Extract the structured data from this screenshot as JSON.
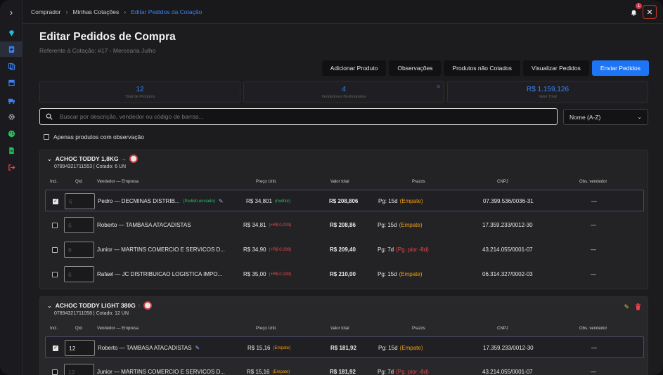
{
  "breadcrumb": [
    "Comprador",
    "Minhas Cotações",
    "Editar Pedidos da Cotação"
  ],
  "notifications_count": "1",
  "page": {
    "title": "Editar Pedidos de Compra",
    "subtitle": "Referente à Cotação: #17 - Mercearia Julho"
  },
  "actions": [
    "Adicionar Produto",
    "Observações",
    "Produtos não Cotados",
    "Visualizar Pedidos",
    "Enviar Pedidos"
  ],
  "stats": [
    {
      "value": "12",
      "label": "Total de Produtos"
    },
    {
      "value": "4",
      "label": "Vendedores Destinatários"
    },
    {
      "value": "R$ 1.159,126",
      "label": "Valor Total"
    }
  ],
  "search": {
    "placeholder": "Buscar por descrição, vendedor ou código de barras..."
  },
  "sort": {
    "selected": "Nome (A-Z)"
  },
  "filter": {
    "obs_only_label": "Apenas produtos com observação"
  },
  "columns": [
    "Incl.",
    "Qtd",
    "Vendedor — Empresa",
    "Preço Unit.",
    "Valor total",
    "Prazos",
    "CNPJ",
    "Obs. vendedor"
  ],
  "groups": [
    {
      "name": "ACHOC TODDY 1,8KG",
      "trend": "→",
      "sub": "07894321711553 | Cotado: 6 UN",
      "rows": [
        {
          "checked": true,
          "qty": "6",
          "vendor": "Pedro — DECMINAS DISTRIB...",
          "tag": "(Pedido enviado)",
          "price": "R$ 34,801",
          "diff": "(melhor)",
          "total": "R$ 208,806",
          "prazo": "Pg: 15d",
          "prazo_tag": "(Empate)",
          "cnpj": "07.399.536/0036-31",
          "obs": "—"
        },
        {
          "checked": false,
          "qty": "6",
          "vendor": "Roberto — TAMBASA ATACADISTAS",
          "tag": "",
          "price": "R$ 34,81",
          "diff": "(+R$ 0,009)",
          "total": "R$ 208,86",
          "prazo": "Pg: 15d",
          "prazo_tag": "(Empate)",
          "cnpj": "17.359.233/0012-30",
          "obs": "—"
        },
        {
          "checked": false,
          "qty": "6",
          "vendor": "Junior — MARTINS COMERCIO E SERVICOS D...",
          "tag": "",
          "price": "R$ 34,90",
          "diff": "(+R$ 0,099)",
          "total": "R$ 209,40",
          "prazo": "Pg: 7d",
          "prazo_tag": "(Pg. pior -8d)",
          "cnpj": "43.214.055/0001-07",
          "obs": "—"
        },
        {
          "checked": false,
          "qty": "6",
          "vendor": "Rafael — JC DISTRIBUICAO LOGISTICA IMPO...",
          "tag": "",
          "price": "R$ 35,00",
          "diff": "(+R$ 0,199)",
          "total": "R$ 210,00",
          "prazo": "Pg: 15d",
          "prazo_tag": "(Empate)",
          "cnpj": "06.314.327/0002-03",
          "obs": "—"
        }
      ]
    },
    {
      "name": "ACHOC TODDY LIGHT 380G",
      "trend": "↑",
      "sub": "07894321711058 | Cotado: 12 UN",
      "rows": [
        {
          "checked": true,
          "qty": "12",
          "vendor": "Roberto — TAMBASA ATACADISTAS",
          "tag": "",
          "price": "R$ 15,16",
          "diff": "(Empate)",
          "total": "R$ 181,92",
          "prazo": "Pg: 15d",
          "prazo_tag": "(Empate)",
          "cnpj": "17.359.233/0012-30",
          "obs": "—"
        },
        {
          "checked": false,
          "qty": "12",
          "vendor": "Junior — MARTINS COMERCIO E SERVICOS D...",
          "tag": "",
          "price": "R$ 15,16",
          "diff": "(Empate)",
          "total": "R$ 181,92",
          "prazo": "Pg: 7d",
          "prazo_tag": "(Pg. pior -8d)",
          "cnpj": "43.214.055/0001-07",
          "obs": "—"
        }
      ]
    }
  ],
  "icons": [
    "chevron-right-icon",
    "diamond-icon",
    "document-icon",
    "copy-icon",
    "store-icon",
    "truck-icon",
    "gear-icon",
    "palette-icon",
    "file-icon",
    "logout-icon",
    "bell-icon",
    "close-icon",
    "search-icon",
    "pencil-icon",
    "trash-icon"
  ],
  "colors": {
    "accent": "#1d74f5",
    "link": "#3b82f6",
    "success": "#22c55e",
    "danger": "#ef4444",
    "warning": "#f59e0b"
  }
}
